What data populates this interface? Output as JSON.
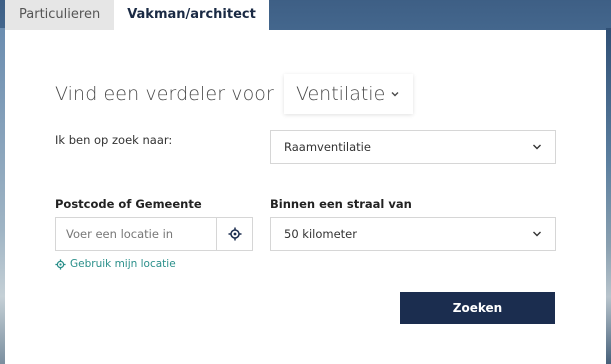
{
  "tabs": [
    {
      "label": "Particulieren",
      "active": false
    },
    {
      "label": "Vakman/architect",
      "active": true
    }
  ],
  "heading": {
    "text": "Vind een verdeler voor",
    "category": "Ventilatie"
  },
  "search_for": {
    "label": "Ik ben op zoek naar:",
    "value": "Raamventilatie"
  },
  "location": {
    "label": "Postcode of Gemeente",
    "placeholder": "Voer een locatie in",
    "use_location_label": "Gebruik mijn locatie"
  },
  "radius": {
    "label": "Binnen een straal van",
    "value": "50 kilometer"
  },
  "search_button": {
    "label": "Zoeken"
  },
  "colors": {
    "accent": "#1b2d4f",
    "link": "#2a8f8a"
  }
}
